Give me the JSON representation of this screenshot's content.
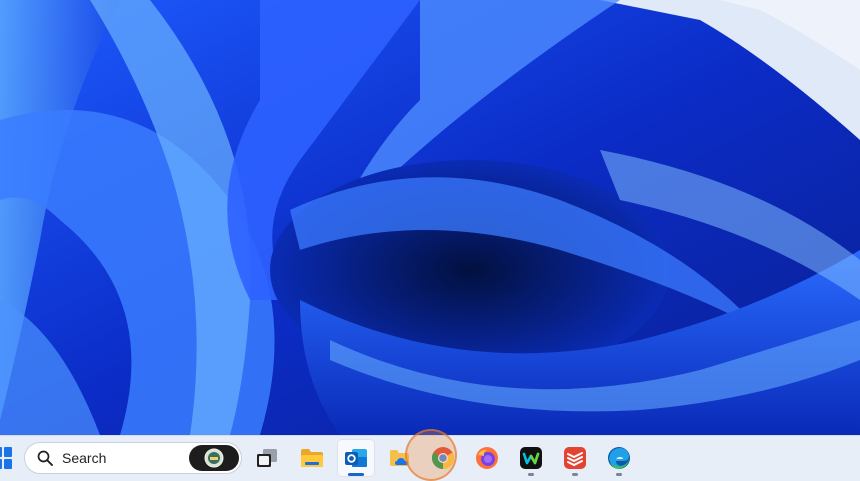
{
  "desktop": {
    "wallpaper": "windows-11-bloom-blue",
    "colors": {
      "deep": "#0a1f8f",
      "mid": "#1546e0",
      "light": "#5aa0ff",
      "sky": "#dfe9f7"
    }
  },
  "taskbar": {
    "background": "#e8eef8",
    "start_icon": "windows-logo-icon",
    "search": {
      "placeholder": "Search",
      "icon": "search-icon",
      "highlight_icon": "search-highlight-badge-icon"
    },
    "apps": [
      {
        "name": "task-view",
        "icon": "task-view-icon",
        "state": "idle"
      },
      {
        "name": "file-explorer",
        "icon": "folder-icon",
        "state": "idle"
      },
      {
        "name": "outlook",
        "icon": "outlook-icon",
        "state": "focused"
      },
      {
        "name": "onedrive-folder",
        "icon": "onedrive-folder-icon",
        "state": "idle"
      },
      {
        "name": "chrome",
        "icon": "chrome-icon",
        "state": "idle"
      },
      {
        "name": "firefox",
        "icon": "firefox-icon",
        "state": "idle"
      },
      {
        "name": "webex",
        "icon": "webex-icon",
        "state": "running"
      },
      {
        "name": "todoist",
        "icon": "todoist-icon",
        "state": "running"
      },
      {
        "name": "edge",
        "icon": "edge-icon",
        "state": "running"
      }
    ]
  }
}
